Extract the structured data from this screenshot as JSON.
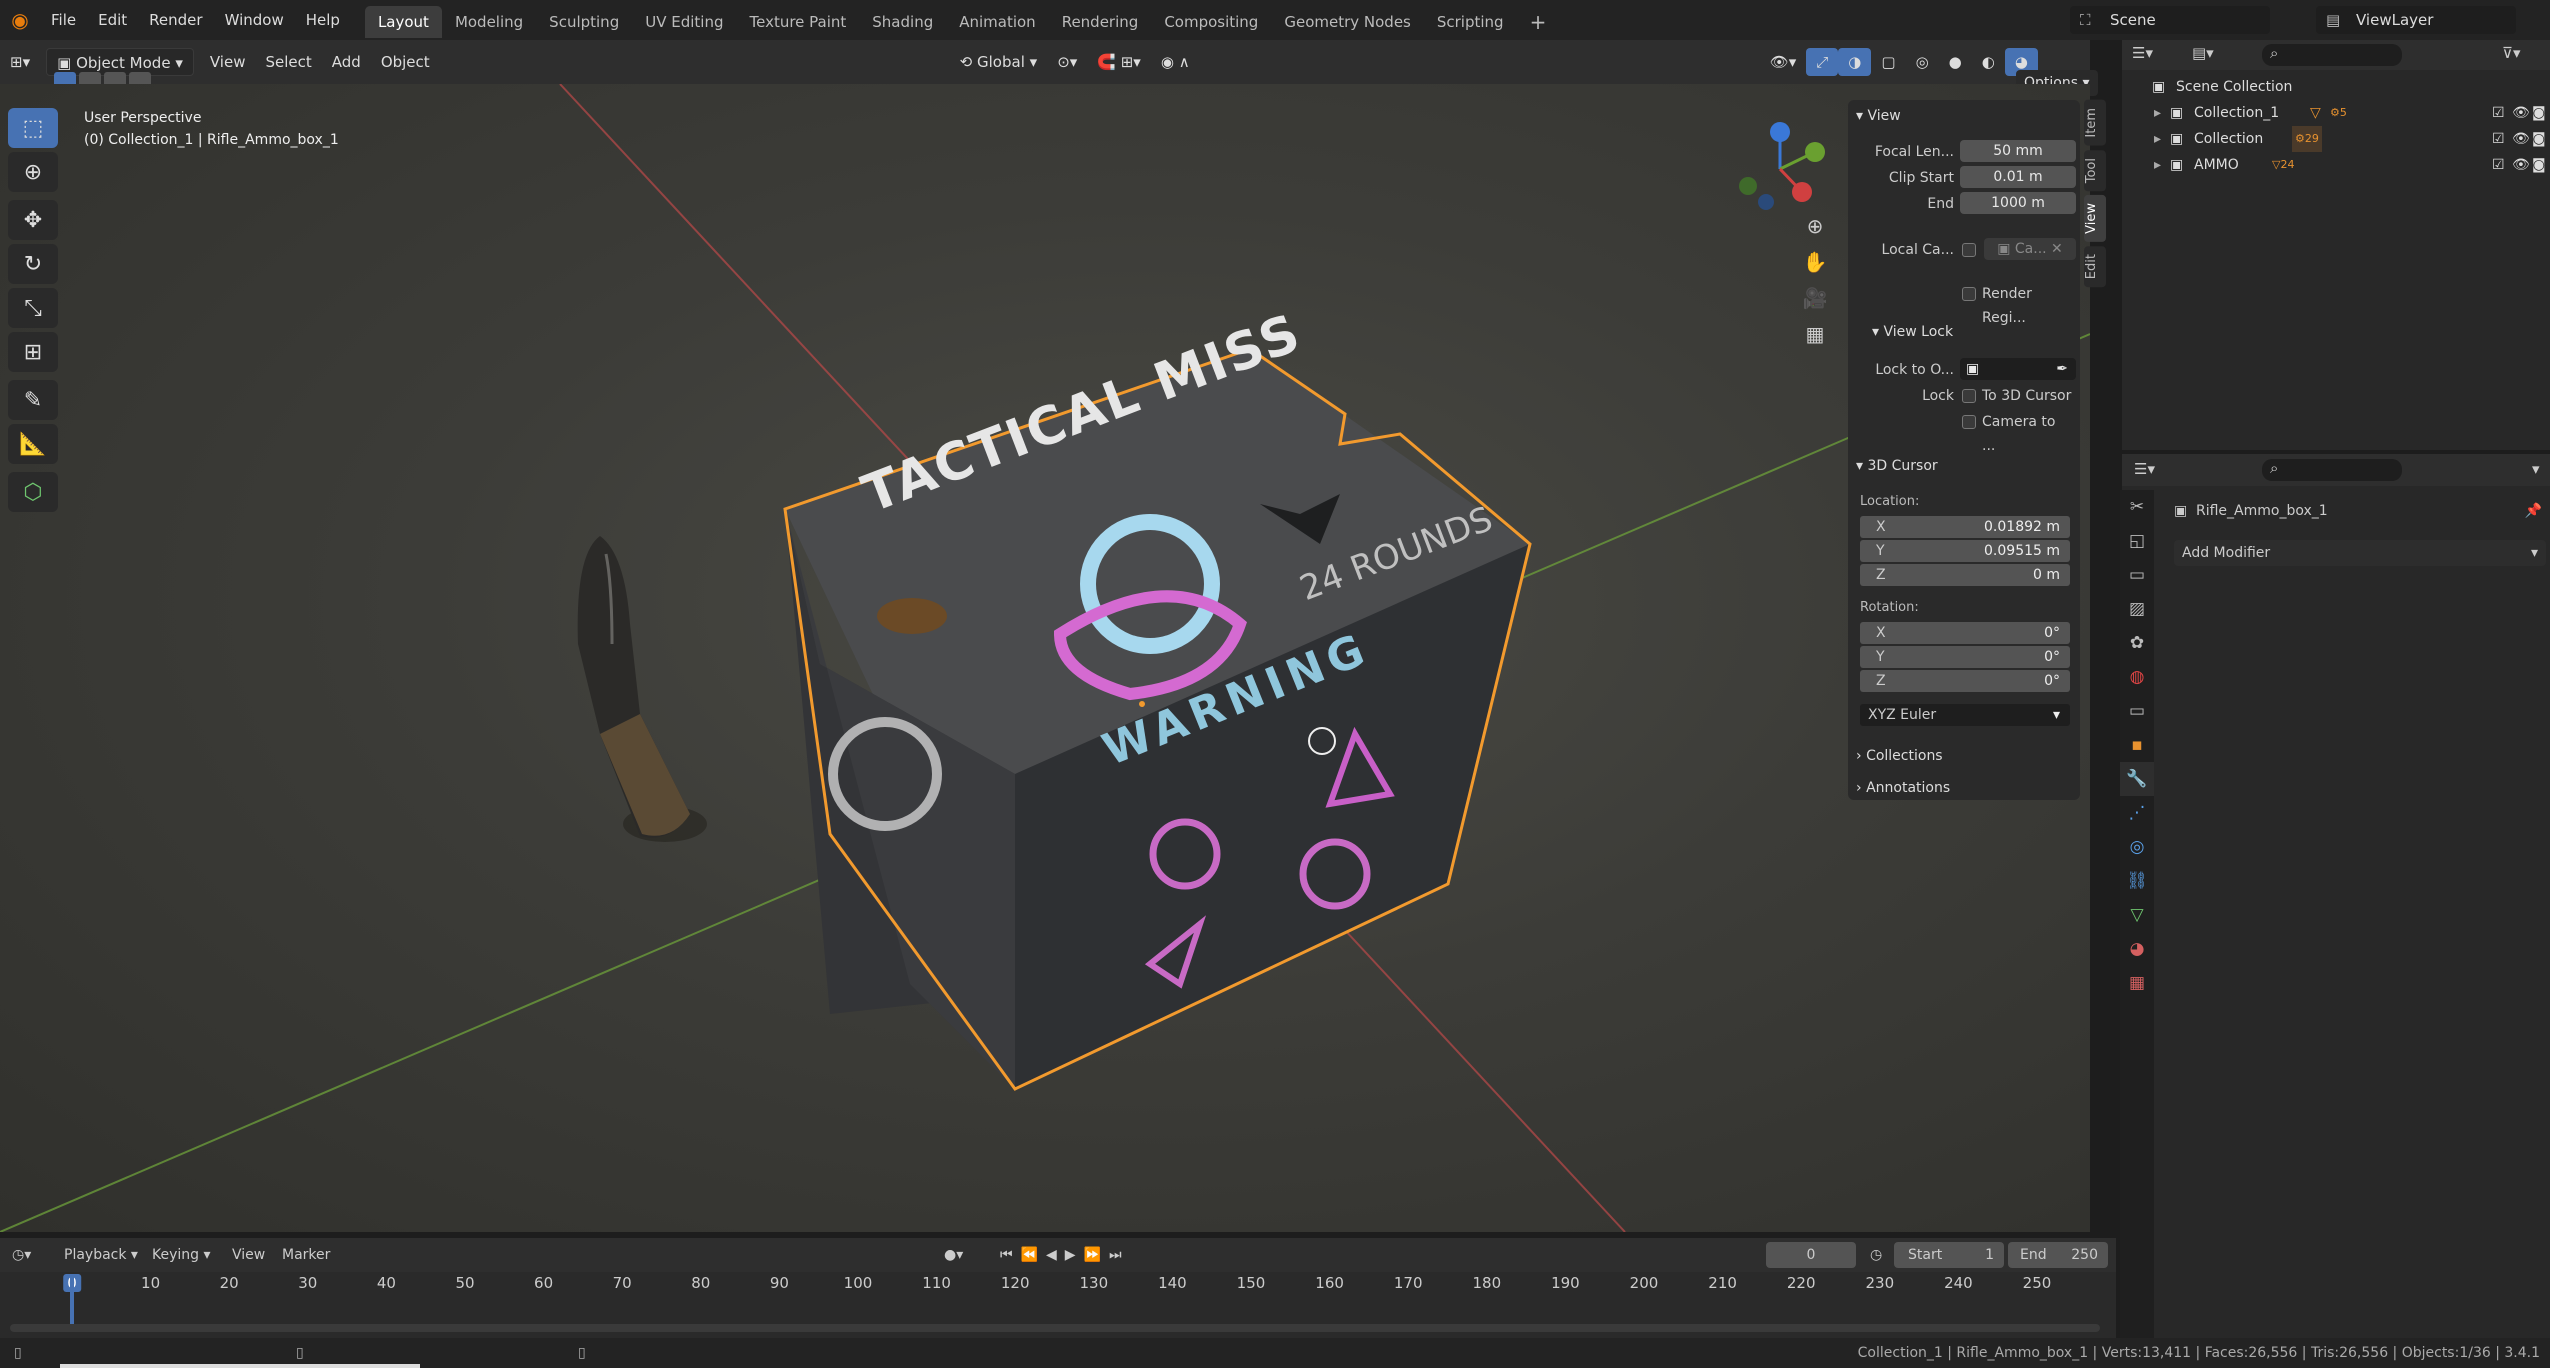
{
  "topbar": {
    "menus": [
      "File",
      "Edit",
      "Render",
      "Window",
      "Help"
    ],
    "workspaces": [
      "Layout",
      "Modeling",
      "Sculpting",
      "UV Editing",
      "Texture Paint",
      "Shading",
      "Animation",
      "Rendering",
      "Compositing",
      "Geometry Nodes",
      "Scripting"
    ],
    "active_workspace": "Layout",
    "scene": "Scene",
    "view_layer": "ViewLayer"
  },
  "header3d": {
    "mode": "Object Mode",
    "menus": [
      "View",
      "Select",
      "Add",
      "Object"
    ],
    "orientation": "Global",
    "options": "Options"
  },
  "viewport": {
    "perspective": "User Perspective",
    "object_info": "(0) Collection_1 | Rifle_Ammo_box_1",
    "box": {
      "title": "TACTICAL MISS",
      "subtitle": "24 ROUNDS",
      "warning": "WARNING"
    }
  },
  "npanel": {
    "tabs": [
      "Item",
      "Tool",
      "View",
      "Edit"
    ],
    "active_tab": "View",
    "view": {
      "header": "View",
      "focal_label": "Focal Len...",
      "focal": "50 mm",
      "clip_start_label": "Clip Start",
      "clip_start": "0.01 m",
      "end_label": "End",
      "end": "1000 m",
      "local_cam_label": "Local Ca...",
      "local_cam": "Ca...",
      "render_region": "Render Regi..."
    },
    "view_lock": {
      "header": "View Lock",
      "lock_obj_label": "Lock to O...",
      "lock_label": "Lock",
      "to_cursor": "To 3D Cursor",
      "camera_to": "Camera to ..."
    },
    "cursor": {
      "header": "3D Cursor",
      "location_label": "Location:",
      "loc": [
        {
          "axis": "X",
          "value": "0.01892 m"
        },
        {
          "axis": "Y",
          "value": "0.09515 m"
        },
        {
          "axis": "Z",
          "value": "0 m"
        }
      ],
      "rotation_label": "Rotation:",
      "rot": [
        {
          "axis": "X",
          "value": "0°"
        },
        {
          "axis": "Y",
          "value": "0°"
        },
        {
          "axis": "Z",
          "value": "0°"
        }
      ],
      "rot_mode": "XYZ Euler"
    },
    "collections": "Collections",
    "annotations": "Annotations"
  },
  "outliner": {
    "root": "Scene Collection",
    "items": [
      {
        "name": "Collection_1",
        "badge": "5"
      },
      {
        "name": "Collection",
        "badge": "29"
      },
      {
        "name": "AMMO",
        "badge": "24"
      }
    ]
  },
  "properties": {
    "object_name": "Rifle_Ammo_box_1",
    "add_modifier": "Add Modifier"
  },
  "timeline": {
    "menus": [
      "Playback",
      "Keying",
      "View",
      "Marker"
    ],
    "current_frame": "0",
    "start_label": "Start",
    "start": "1",
    "end_label": "End",
    "end": "250",
    "ticks": [
      "0",
      "10",
      "20",
      "30",
      "40",
      "50",
      "60",
      "70",
      "80",
      "90",
      "100",
      "110",
      "120",
      "130",
      "140",
      "150",
      "160",
      "170",
      "180",
      "190",
      "200",
      "210",
      "220",
      "230",
      "240",
      "250"
    ]
  },
  "status": {
    "text": "Collection_1 | Rifle_Ammo_box_1 | Verts:13,411 | Faces:26,556 | Tris:26,556 | Objects:1/36 | 3.4.1"
  }
}
